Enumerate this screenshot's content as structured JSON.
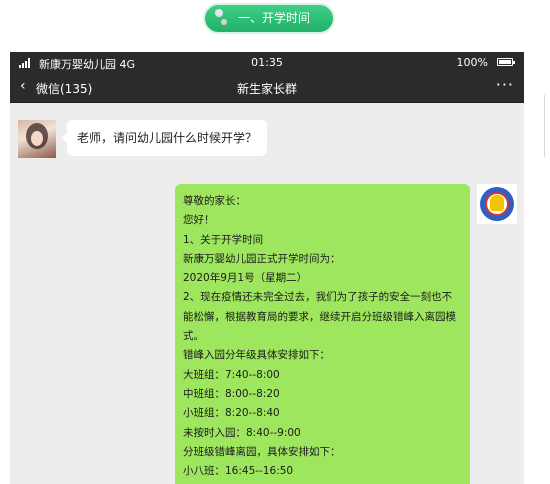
{
  "section_header": {
    "text": "一、开学时间"
  },
  "status_bar": {
    "carrier": "新康万婴幼儿园 4G",
    "time": "01:35",
    "battery_percent": "100%",
    "battery_level": 1.0
  },
  "nav": {
    "back_label": "微信(135)",
    "title": "新生家长群",
    "more": "···"
  },
  "messages": {
    "incoming": {
      "text": "老师，请问幼儿园什么时候开学？"
    },
    "outgoing": {
      "lines": [
        "尊敬的家长：",
        "您好！",
        "1、关于开学时间",
        "新康万婴幼儿园正式开学时间为：",
        "2020年9月1号（星期二）",
        "2、现在疫情还未完全过去，我们为了孩子的安全一刻也不能松懈，根据教育局的要求，继续开启分班级错峰入离园模式。",
        "错峰入园分年级具体安排如下：",
        "大班组：7:40--8:00",
        "中班组：8:00--8:20",
        "小班组：8:20--8:40",
        "未按时入园：8:40--9:00",
        "分班级错峰离园，具体安排如下：",
        "小八班：16:45--16:50"
      ]
    }
  },
  "colors": {
    "header_green": "#22b06a",
    "bar_dark": "#2b2b2b",
    "chat_bg": "#ededed",
    "bubble_green": "#9fe65f"
  }
}
